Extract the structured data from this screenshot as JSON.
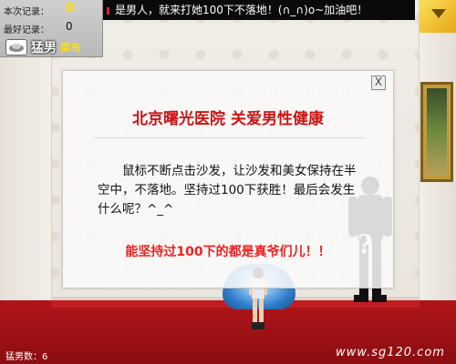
{
  "hud": {
    "current_label": "本次记录：",
    "current_value": "0",
    "best_label": "最好记录：",
    "best_value": "0",
    "rank_title": "猛男",
    "rank_subtitle": "菜鸟"
  },
  "ticker": {
    "text": "是男人，就来打她100下不落地！(∩_∩)o~加油吧！"
  },
  "dialog": {
    "title": "北京曙光医院 关爱男性健康",
    "close_label": "X",
    "body": "鼠标不断点击沙发，让沙发和美女保持在半空中，不落地。坚持过100下获胜！最后会发生什么呢？^_^",
    "note": "能坚持过100下的都是真爷们儿！！"
  },
  "footer": {
    "count_label": "猛男数：",
    "count_value": "6",
    "site": "www.sg120.com"
  },
  "colors": {
    "title_red": "#c91515",
    "note_red": "#ef2020",
    "score_yellow": "#ffe000",
    "floor": "#9e1014"
  }
}
